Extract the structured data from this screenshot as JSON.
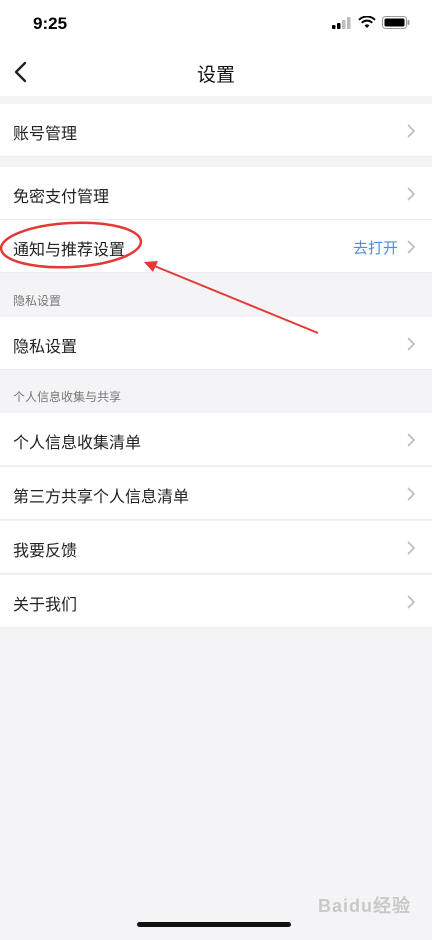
{
  "status_bar": {
    "time": "9:25"
  },
  "nav": {
    "title": "设置"
  },
  "rows": {
    "account": {
      "label": "账号管理"
    },
    "pay": {
      "label": "免密支付管理"
    },
    "notify": {
      "label": "通知与推荐设置",
      "value": "去打开"
    },
    "privacy": {
      "label": "隐私设置"
    },
    "collect": {
      "label": "个人信息收集清单"
    },
    "thirdparty": {
      "label": "第三方共享个人信息清单"
    },
    "feedback": {
      "label": "我要反馈"
    },
    "about": {
      "label": "关于我们"
    }
  },
  "sections": {
    "privacy_header": "隐私设置",
    "info_header": "个人信息收集与共享"
  },
  "watermark": "Baidu经验",
  "colors": {
    "accent": "#4a90e2",
    "annotation": "#e53935",
    "background": "#f4f4f6"
  },
  "icons": [
    "back-arrow-icon",
    "chevron-right-icon",
    "signal-icon",
    "wifi-icon",
    "battery-icon"
  ]
}
